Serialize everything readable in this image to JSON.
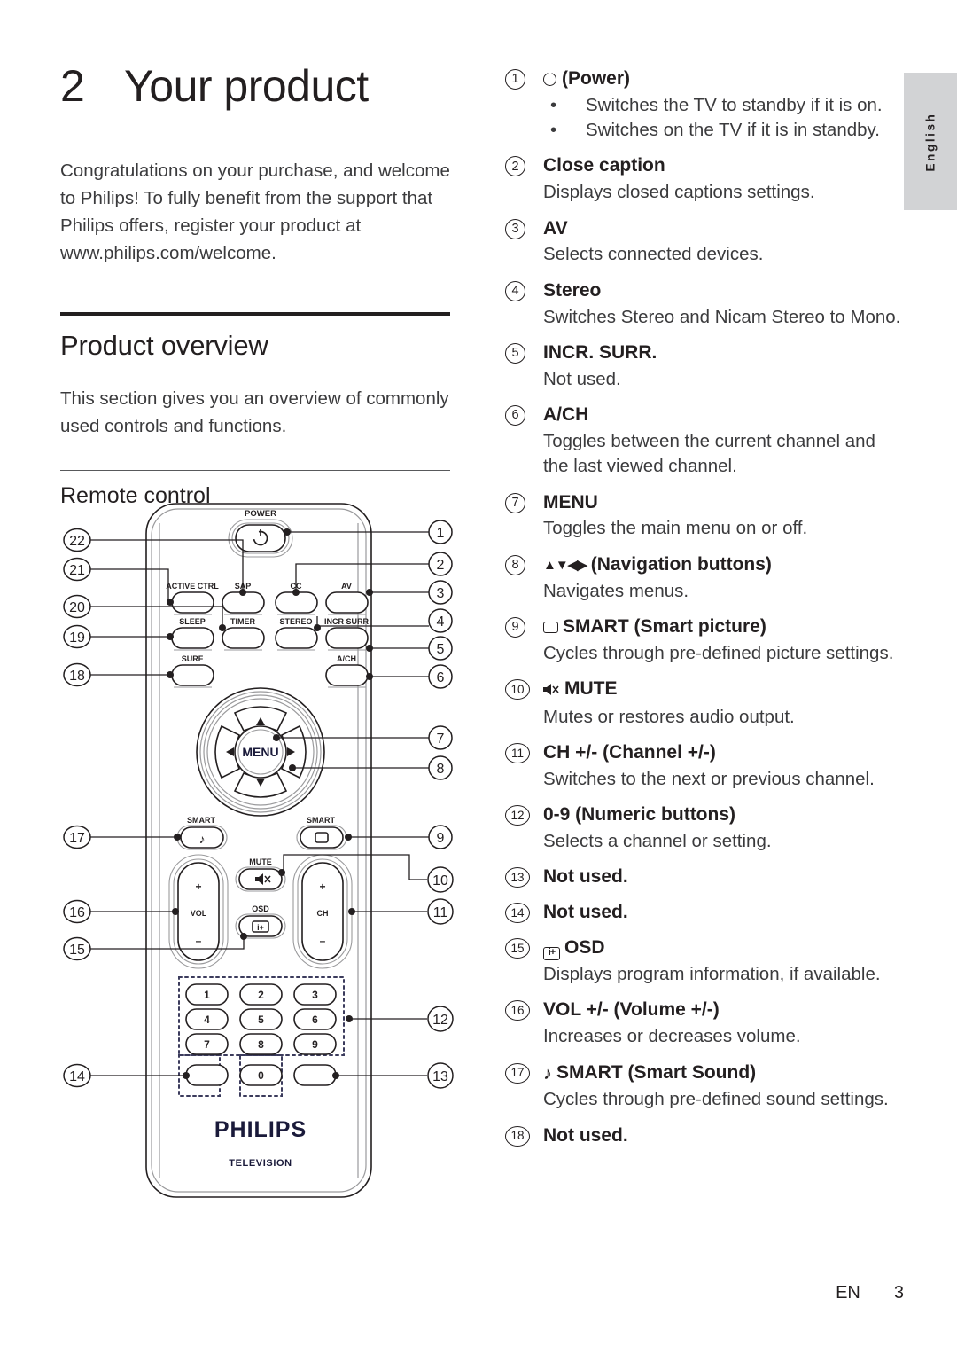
{
  "chapter": {
    "number": "2",
    "title": "Your product"
  },
  "intro": "Congratulations on your purchase, and welcome to Philips! To fully benefit from the support that Philips offers, register your product at www.philips.com/welcome.",
  "section": {
    "heading": "Product overview",
    "body": "This section gives you an overview of commonly used controls and functions.",
    "subheading": "Remote control"
  },
  "remote": {
    "brand": "PHILIPS",
    "brand_sub": "TELEVISION",
    "power_label": "POWER",
    "buttons_row1": [
      "ACTIVE CTRL",
      "SAP",
      "CC",
      "AV"
    ],
    "buttons_row2": [
      "SLEEP",
      "TIMER",
      "STEREO",
      "INCR SURR"
    ],
    "buttons_row3": [
      "SURF",
      "A/CH"
    ],
    "menu_label": "MENU",
    "smart_left_label": "SMART",
    "smart_right_label": "SMART",
    "mute_label": "MUTE",
    "osd_label": "OSD",
    "vol_label": "VOL",
    "ch_label": "CH",
    "plus": "+",
    "minus": "–",
    "keypad": [
      "1",
      "2",
      "3",
      "4",
      "5",
      "6",
      "7",
      "8",
      "9"
    ],
    "zero": "0",
    "callouts_left": [
      "22",
      "21",
      "20",
      "19",
      "18",
      "17",
      "16",
      "15",
      "14"
    ],
    "callouts_right": [
      "1",
      "2",
      "3",
      "4",
      "5",
      "6",
      "7",
      "8",
      "9",
      "10",
      "11",
      "12",
      "13"
    ]
  },
  "legend": [
    {
      "num": "1",
      "icon": "power-icon",
      "title": "(Power)",
      "bullets": [
        "Switches the TV to standby if it is on.",
        "Switches on the TV if it is in standby."
      ]
    },
    {
      "num": "2",
      "title": "Close caption",
      "desc": "Displays closed captions settings."
    },
    {
      "num": "3",
      "title": "AV",
      "desc": "Selects connected devices."
    },
    {
      "num": "4",
      "title": "Stereo",
      "desc": "Switches Stereo and Nicam Stereo to Mono."
    },
    {
      "num": "5",
      "title": "INCR. SURR.",
      "desc": "Not used."
    },
    {
      "num": "6",
      "title": "A/CH",
      "desc": "Toggles between the current channel and the last viewed channel."
    },
    {
      "num": "7",
      "title": "MENU",
      "desc": "Toggles the main menu on or off."
    },
    {
      "num": "8",
      "icon": "navigation-arrows-icon",
      "icon_text": "▲▼◀▶",
      "title": "(Navigation buttons)",
      "desc": "Navigates menus."
    },
    {
      "num": "9",
      "icon": "rectangle-icon",
      "title": "SMART (Smart picture)",
      "desc": "Cycles through pre-defined picture settings."
    },
    {
      "num": "10",
      "icon": "mute-icon",
      "title": "MUTE",
      "desc": "Mutes or restores audio output."
    },
    {
      "num": "11",
      "title": "CH +/- (Channel +/-)",
      "desc": "Switches to the next or previous channel."
    },
    {
      "num": "12",
      "title": "0-9 (Numeric buttons)",
      "desc": "Selects a channel or setting."
    },
    {
      "num": "13",
      "title": "Not used."
    },
    {
      "num": "14",
      "title": "Not used."
    },
    {
      "num": "15",
      "icon": "osd-icon",
      "icon_text": "i+",
      "title": "OSD",
      "desc": "Displays program information, if available."
    },
    {
      "num": "16",
      "title": "VOL +/- (Volume +/-)",
      "desc": "Increases or decreases volume."
    },
    {
      "num": "17",
      "icon": "music-note-icon",
      "icon_text": "♪",
      "title": "SMART (Smart Sound)",
      "desc": "Cycles through pre-defined sound settings."
    },
    {
      "num": "18",
      "title": "Not used."
    }
  ],
  "side_tab": {
    "label": "English"
  },
  "footer": {
    "language": "EN",
    "page": "3"
  }
}
